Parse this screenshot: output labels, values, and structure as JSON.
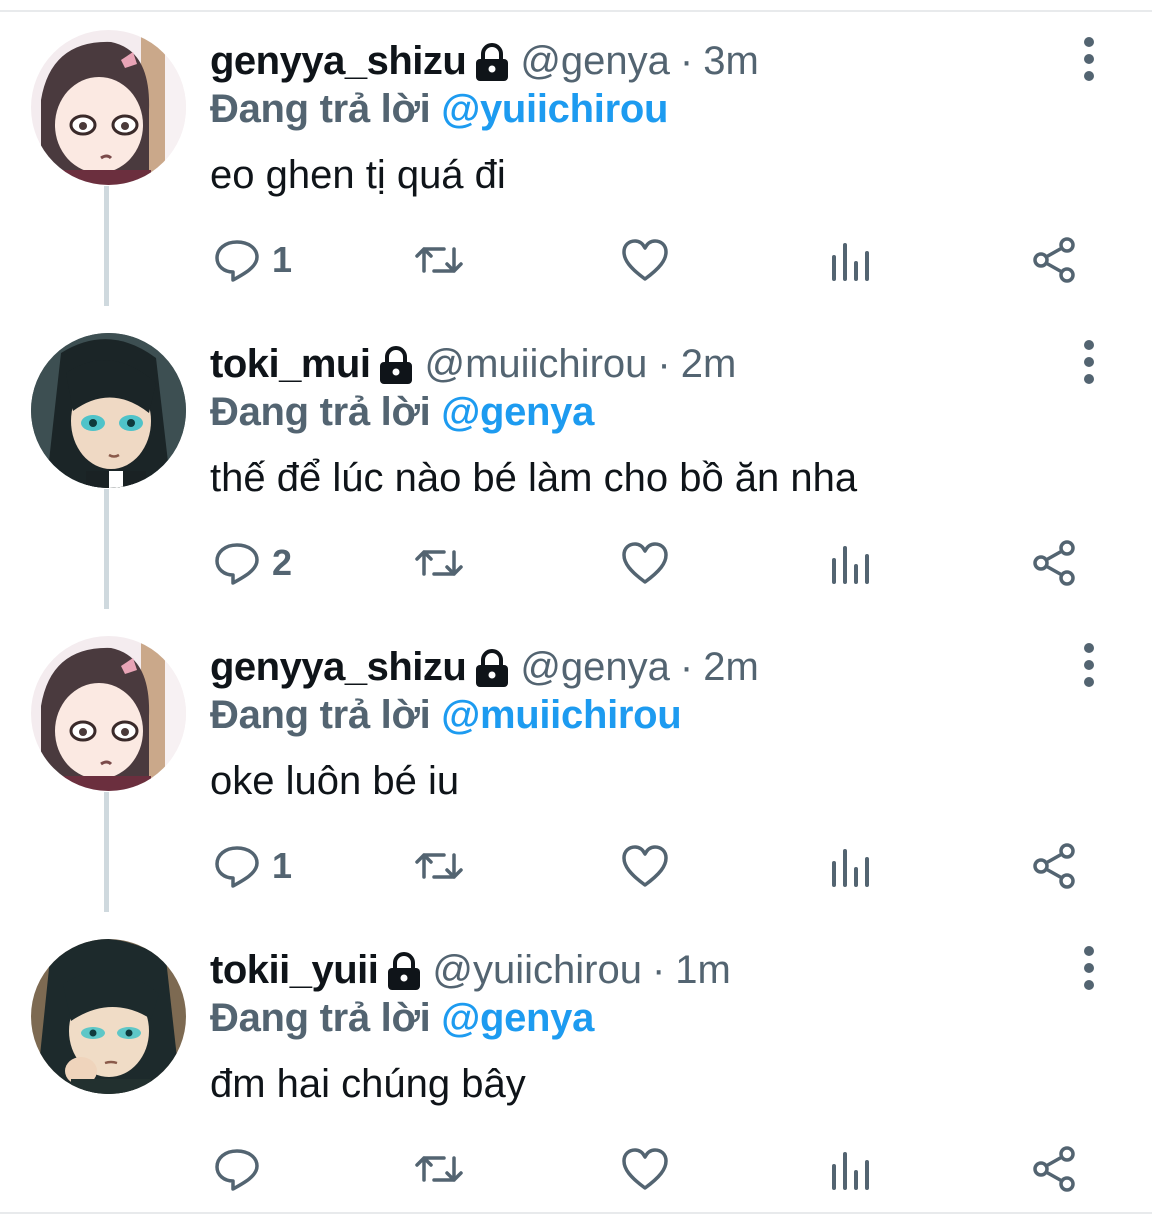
{
  "colors": {
    "text": "#0f1419",
    "muted": "#536471",
    "link": "#1d9bf0",
    "thread": "#cfd9de"
  },
  "tweets": [
    {
      "name": "genyya_shizu",
      "handle": "@genya",
      "sep": "·",
      "time": "3m",
      "reply_prefix": "Đang trả lời",
      "reply_to": "@yuiichirou",
      "text": "eo ghen tị quá đi",
      "reply_count": "1",
      "avatar": "pink-hair-avatar"
    },
    {
      "name": "toki_mui",
      "handle": "@muiichirou",
      "sep": "·",
      "time": "2m",
      "reply_prefix": "Đang trả lời",
      "reply_to": "@genya",
      "text": "thế để lúc nào bé làm cho bồ ăn nha",
      "reply_count": "2",
      "avatar": "dark-hair-avatar"
    },
    {
      "name": "genyya_shizu",
      "handle": "@genya",
      "sep": "·",
      "time": "2m",
      "reply_prefix": "Đang trả lời",
      "reply_to": "@muiichirou",
      "text": "oke luôn bé iu",
      "reply_count": "1",
      "avatar": "pink-hair-avatar"
    },
    {
      "name": "tokii_yuii",
      "handle": "@yuiichirou",
      "sep": "·",
      "time": "1m",
      "reply_prefix": "Đang trả lời",
      "reply_to": "@genya",
      "text": "đm hai chúng bây",
      "reply_count": "",
      "avatar": "dark-hair-avatar"
    }
  ]
}
